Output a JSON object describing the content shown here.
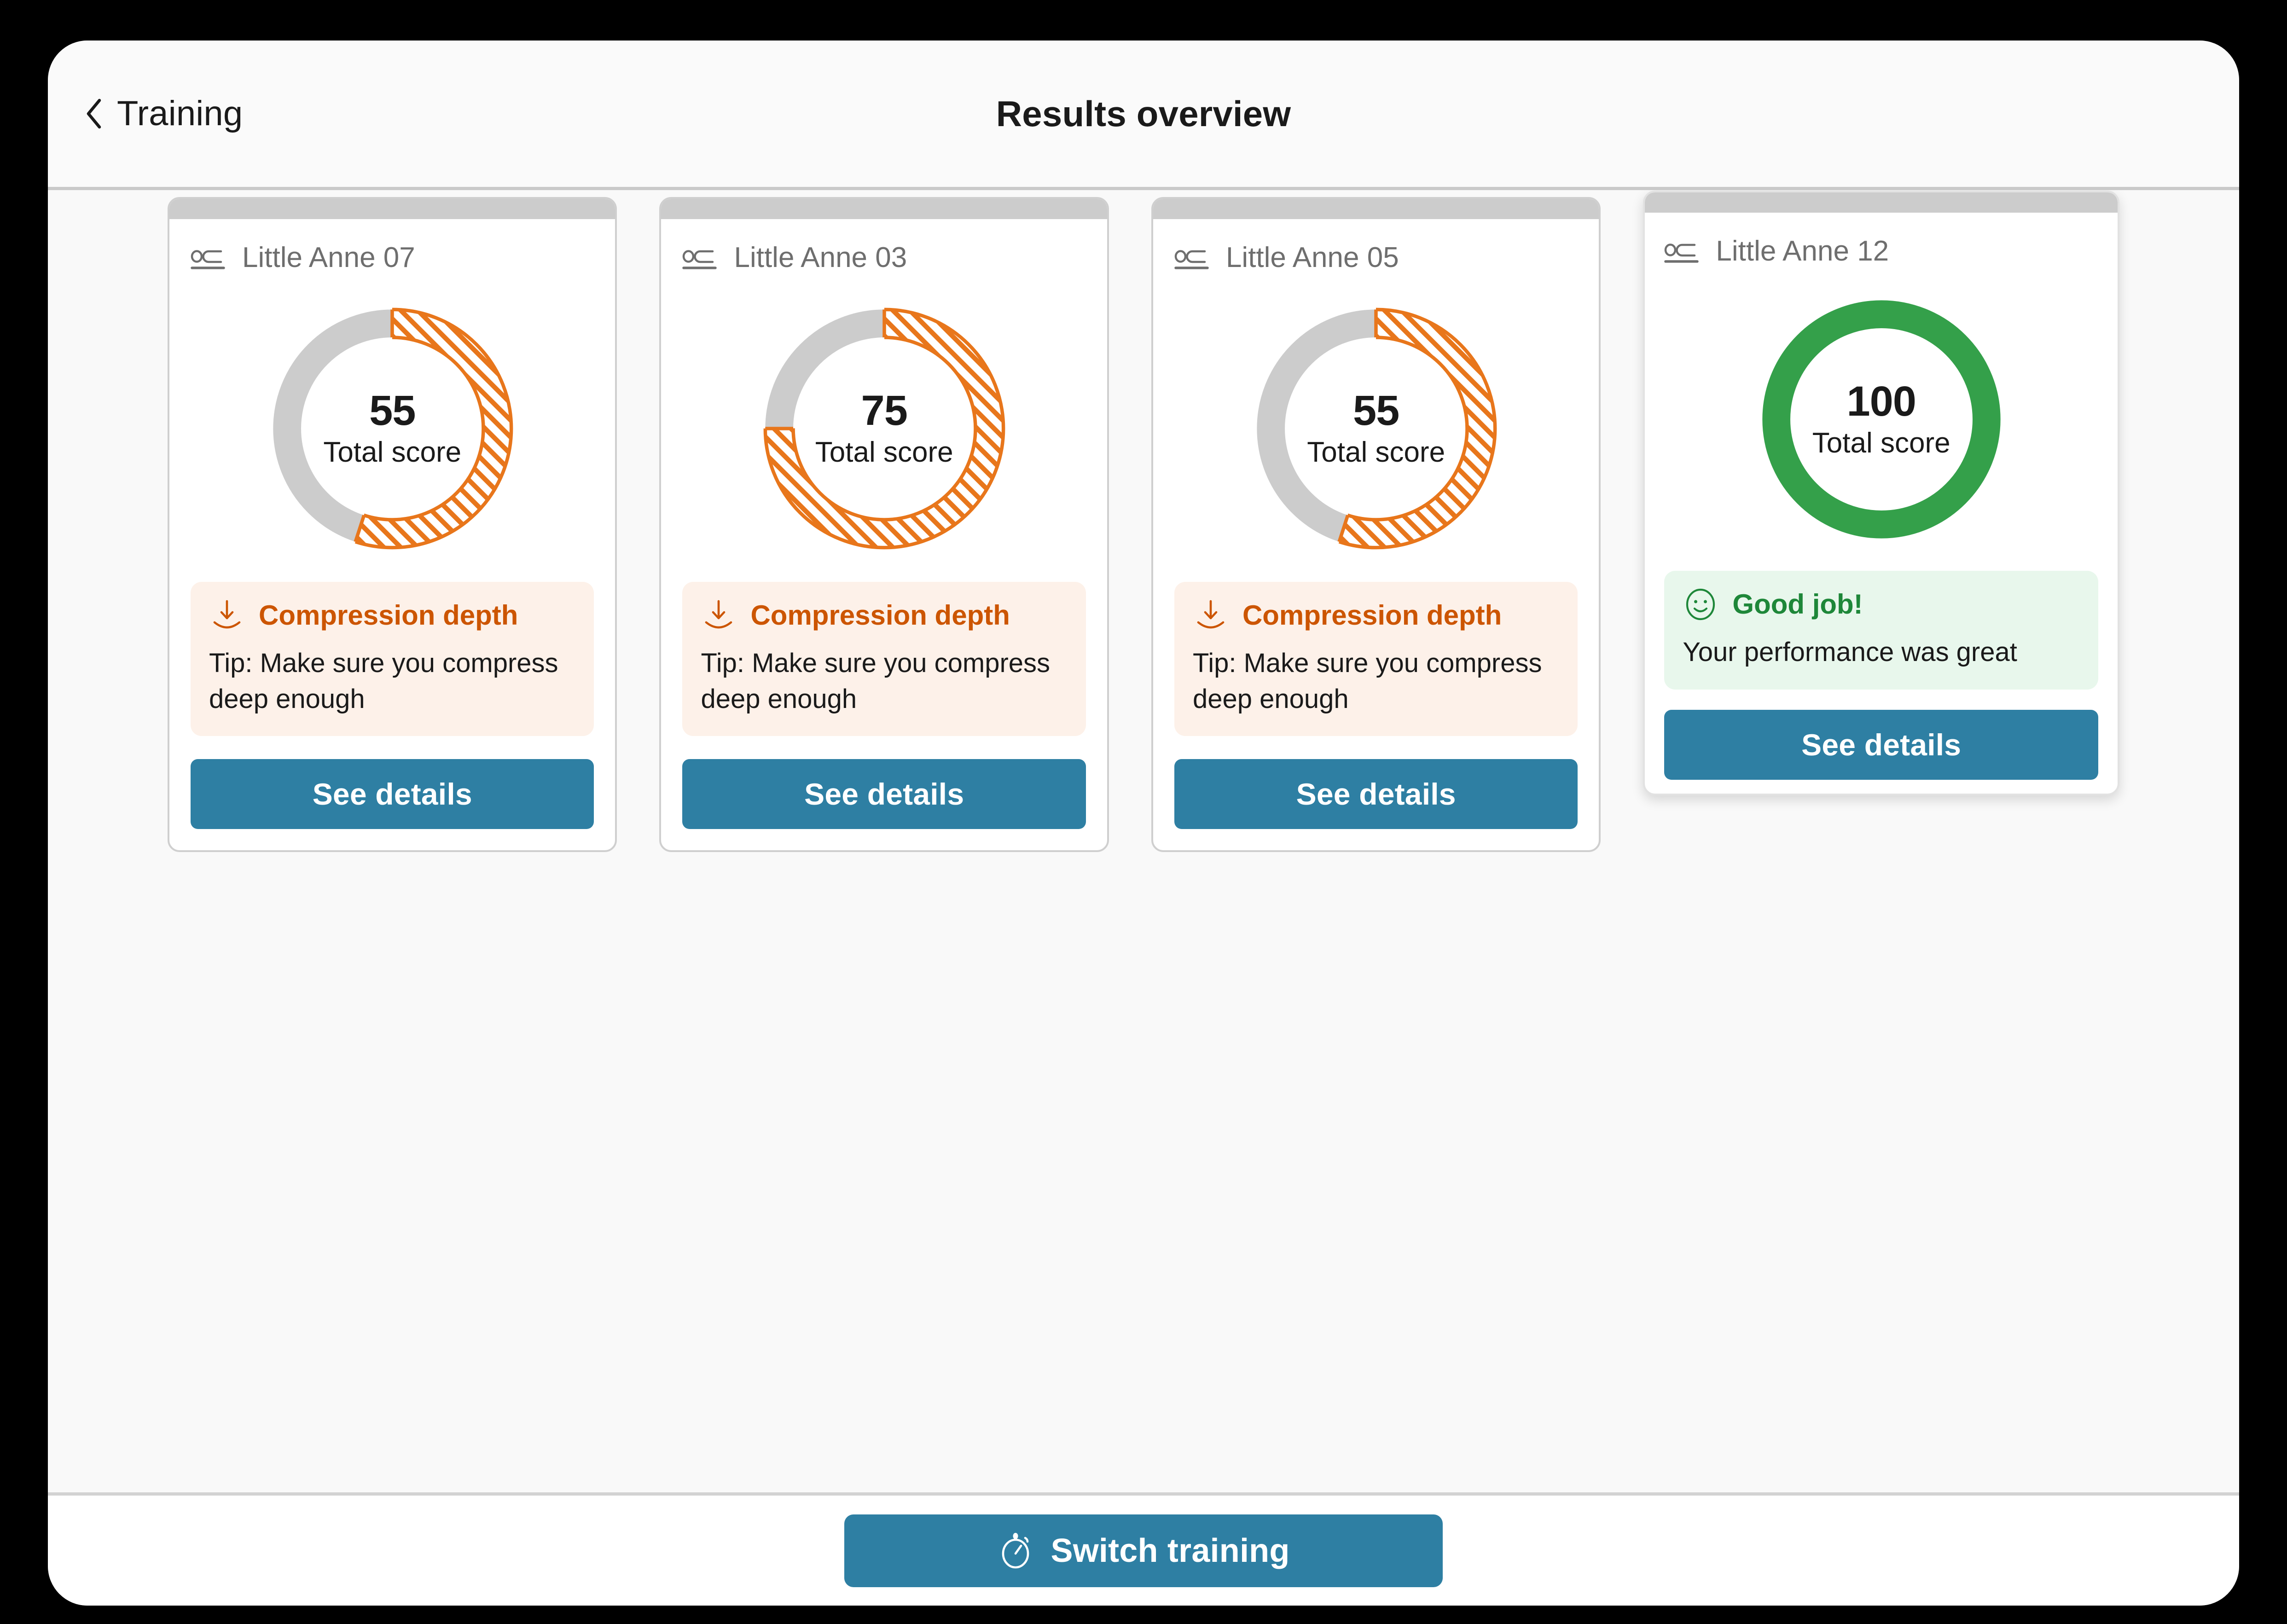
{
  "header": {
    "back_label": "Training",
    "back_icon": "chevron-left-icon",
    "title": "Results overview"
  },
  "colors": {
    "accent_blue": "#2E7FA3",
    "orange": "#E8761B",
    "orange_text": "#CC5500",
    "green": "#34A853",
    "green_ring": "#34A04A",
    "green_text": "#1E8739",
    "track_gray": "#CCCCCC",
    "warn_bg": "#FDF1E9",
    "good_bg": "#E8F7EC",
    "card_border": "#CFCFCF",
    "page_bg": "#F9F9F9"
  },
  "cards": [
    {
      "manikin_icon": "manikin-icon",
      "manikin_name": "Little Anne 07",
      "score": "55",
      "score_label": "Total score",
      "ring_state": "partial",
      "feedback_variant": "warn",
      "feedback_icon": "compression-depth-icon",
      "feedback_title": "Compression depth",
      "feedback_text": "Tip: Make sure you compress deep enough",
      "details_label": "See details"
    },
    {
      "manikin_icon": "manikin-icon",
      "manikin_name": "Little Anne 03",
      "score": "75",
      "score_label": "Total score",
      "ring_state": "partial",
      "feedback_variant": "warn",
      "feedback_icon": "compression-depth-icon",
      "feedback_title": "Compression depth",
      "feedback_text": "Tip: Make sure you compress deep enough",
      "details_label": "See details"
    },
    {
      "manikin_icon": "manikin-icon",
      "manikin_name": "Little Anne 05",
      "score": "55",
      "score_label": "Total score",
      "ring_state": "partial",
      "feedback_variant": "warn",
      "feedback_icon": "compression-depth-icon",
      "feedback_title": "Compression depth",
      "feedback_text": "Tip: Make sure you compress deep enough",
      "details_label": "See details"
    },
    {
      "manikin_icon": "manikin-icon",
      "manikin_name": "Little Anne 12",
      "score": "100",
      "score_label": "Total score",
      "ring_state": "complete",
      "feedback_variant": "good",
      "feedback_icon": "smiley-face-icon",
      "feedback_title": "Good job!",
      "feedback_text": "Your performance was great",
      "details_label": "See details"
    }
  ],
  "chart_data": [
    {
      "type": "pie",
      "title": "Little Anne 07 total score",
      "categories": [
        "Score",
        "Remaining"
      ],
      "values": [
        55,
        45
      ],
      "center_value": 55,
      "center_label": "Total score",
      "ylim": [
        0,
        100
      ],
      "colors": [
        "#E8761B",
        "#CCCCCC"
      ],
      "style": "donut, hatched fill for score segment, starts at 12 o'clock clockwise"
    },
    {
      "type": "pie",
      "title": "Little Anne 03 total score",
      "categories": [
        "Score",
        "Remaining"
      ],
      "values": [
        75,
        25
      ],
      "center_value": 75,
      "center_label": "Total score",
      "ylim": [
        0,
        100
      ],
      "colors": [
        "#E8761B",
        "#CCCCCC"
      ],
      "style": "donut, hatched fill for score segment, starts at 12 o'clock clockwise"
    },
    {
      "type": "pie",
      "title": "Little Anne 05 total score",
      "categories": [
        "Score",
        "Remaining"
      ],
      "values": [
        55,
        45
      ],
      "center_value": 55,
      "center_label": "Total score",
      "ylim": [
        0,
        100
      ],
      "colors": [
        "#E8761B",
        "#CCCCCC"
      ],
      "style": "donut, hatched fill for score segment, starts at 12 o'clock clockwise"
    },
    {
      "type": "pie",
      "title": "Little Anne 12 total score",
      "categories": [
        "Score",
        "Remaining"
      ],
      "values": [
        100,
        0
      ],
      "center_value": 100,
      "center_label": "Total score",
      "ylim": [
        0,
        100
      ],
      "colors": [
        "#34A04A",
        "#CCCCCC"
      ],
      "style": "donut, solid green full ring"
    }
  ],
  "footer": {
    "switch_label": "Switch training",
    "switch_icon": "stopwatch-icon"
  }
}
